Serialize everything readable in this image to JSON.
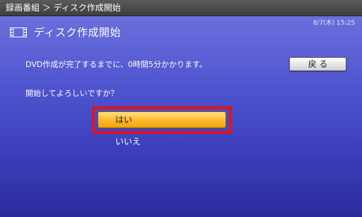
{
  "topbar": {
    "breadcrumb": "録画番組 ＞ ディスク作成開始"
  },
  "status": {
    "datetime": "8/7(木) 15:25"
  },
  "header": {
    "title": "ディスク作成開始",
    "icon": "film-icon"
  },
  "dialog": {
    "message": "DVD作成が完了するまでに、0時間5分かかります。",
    "question": "開始してよろしいですか？",
    "back_label": "戻 る",
    "yes_label": "はい",
    "no_label": "いいえ"
  },
  "colors": {
    "focus_border": "#e0141c",
    "yes_button": "#ffbe33",
    "background": "#3a3db0"
  }
}
